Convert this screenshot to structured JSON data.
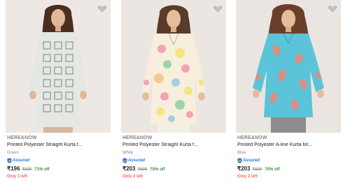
{
  "products": [
    {
      "brand": "HERE&NOW",
      "title": "Printed Polyester Straight Kurta f...",
      "color": "Green",
      "assured": "Assured",
      "price": "₹196",
      "mrp": "₹699",
      "discount": "71% off",
      "stock": "Only 1 left",
      "kurta_color": "#e4e7e2",
      "pattern_color": "#7b8a86"
    },
    {
      "brand": "HERE&NOW",
      "title": "Printed Polyester Straight Kurta f...",
      "color": "White",
      "assured": "Assured",
      "price": "₹203",
      "mrp": "₹699",
      "discount": "70% off",
      "stock": "Only 2 left",
      "kurta_color": "#f7efdc",
      "pattern_color": "#f29bb5"
    },
    {
      "brand": "HERE&NOW",
      "title": "Printed Polyester A-line Kurta for...",
      "color": "Blue",
      "assured": "Assured",
      "price": "₹203",
      "mrp": "₹699",
      "discount": "70% off",
      "stock": "Only 2 left",
      "kurta_color": "#5bc4d8",
      "pattern_color": "#e88a7a"
    }
  ],
  "icons": {
    "wishlist": "heart-icon",
    "assured": "shield-check-icon"
  },
  "colors": {
    "assured_blue": "#2874f0",
    "discount_green": "#388e3c",
    "stock_red": "#ff6161",
    "muted_gray": "#878787"
  }
}
